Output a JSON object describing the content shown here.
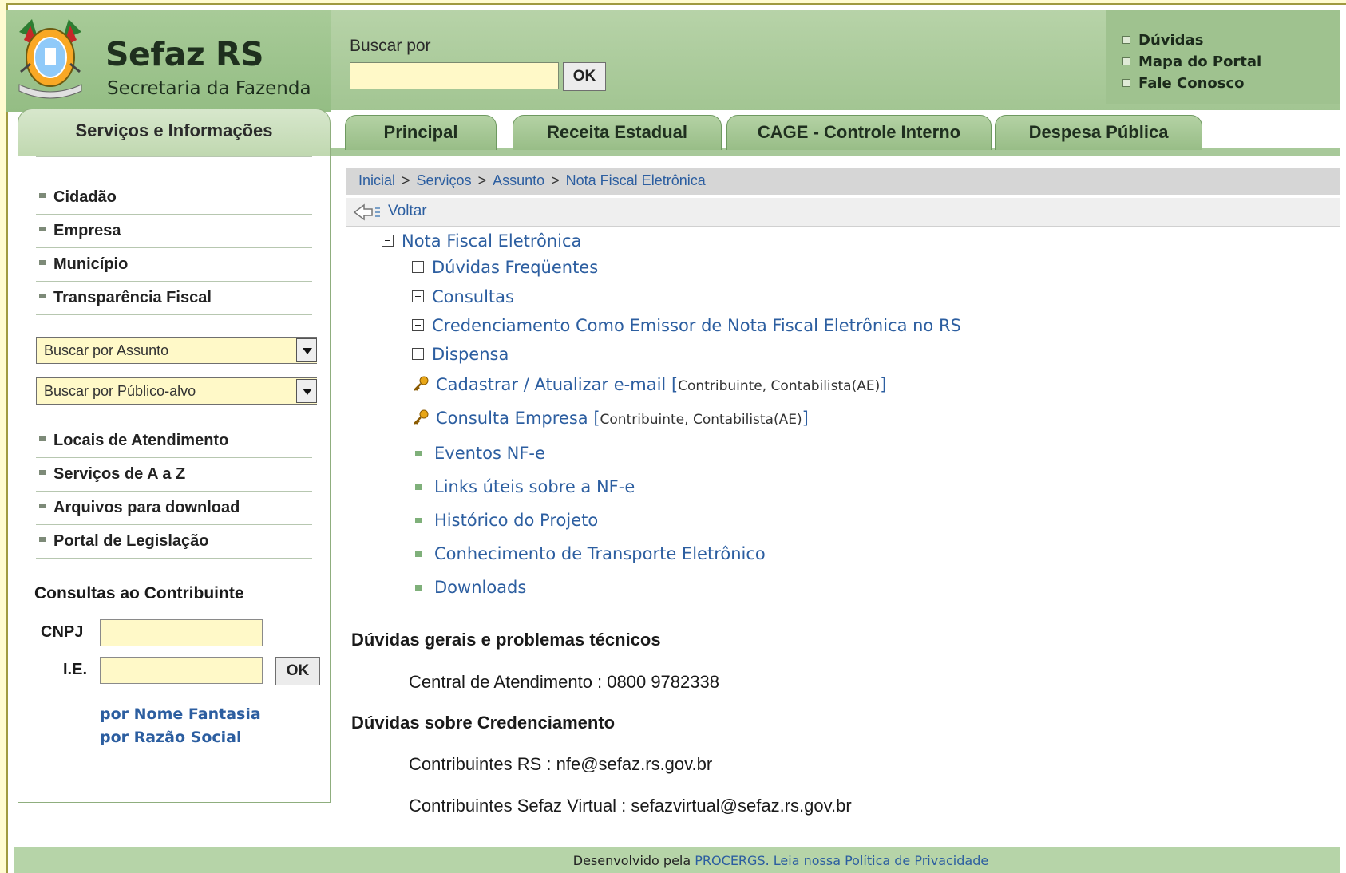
{
  "header": {
    "brand_title": "Sefaz RS",
    "brand_subtitle": "Secretaria da Fazenda",
    "search_label": "Buscar por",
    "search_value": "",
    "search_button": "OK",
    "top_links": [
      "Dúvidas",
      "Mapa do Portal",
      "Fale Conosco"
    ]
  },
  "nav": {
    "left_tab": "Serviços e Informações",
    "tabs": [
      "Principal",
      "Receita Estadual",
      "CAGE - Controle Interno",
      "Despesa Pública"
    ]
  },
  "sidebar": {
    "items_top": [
      "Cidadão",
      "Empresa",
      "Município",
      "Transparência Fiscal"
    ],
    "select_assunto": "Buscar por Assunto",
    "select_publico": "Buscar por Público-alvo",
    "items_bottom": [
      "Locais de Atendimento",
      "Serviços de A a Z",
      "Arquivos para download",
      "Portal de Legislação"
    ],
    "consultas_title": "Consultas ao Contribuinte",
    "cnpj_label": "CNPJ",
    "ie_label": "I.E.",
    "ok_button": "OK",
    "link_fantasia": "por Nome Fantasia",
    "link_razao": "por Razão Social"
  },
  "breadcrumb": {
    "items": [
      "Inicial",
      "Serviços",
      "Assunto",
      "Nota Fiscal Eletrônica"
    ],
    "separator": ">"
  },
  "back_label": "Voltar",
  "tree": {
    "root": "Nota Fiscal Eletrônica",
    "expandable": [
      "Dúvidas Freqüentes",
      "Consultas",
      "Credenciamento Como Emissor de Nota Fiscal Eletrônica no RS",
      "Dispensa"
    ],
    "restricted": [
      {
        "label": "Cadastrar / Atualizar e-mail",
        "tag": "Contribuinte, Contabilista(AE)"
      },
      {
        "label": "Consulta Empresa",
        "tag": "Contribuinte, Contabilista(AE)"
      }
    ],
    "links": [
      "Eventos NF-e",
      "Links úteis sobre a NF-e",
      "Histórico do Projeto",
      "Conhecimento de Transporte Eletrônico",
      "Downloads"
    ]
  },
  "info": {
    "title_gerais": "Dúvidas gerais e problemas técnicos",
    "central": "Central de Atendimento : 0800 9782338",
    "title_credenciamento": "Dúvidas sobre Credenciamento",
    "contrib_rs": "Contribuintes RS : nfe@sefaz.rs.gov.br",
    "contrib_virtual": "Contribuintes Sefaz Virtual : sefazvirtual@sefaz.rs.gov.br"
  },
  "footer": {
    "prefix": "Desenvolvido pela",
    "procergs": "PROCERGS.",
    "privacy": "Leia nossa Política de Privacidade"
  },
  "colors": {
    "header_green": "#a2c592",
    "link_blue": "#2c5ea0",
    "input_yellow": "#fff9c8",
    "footer_green": "#b6d4a8"
  }
}
